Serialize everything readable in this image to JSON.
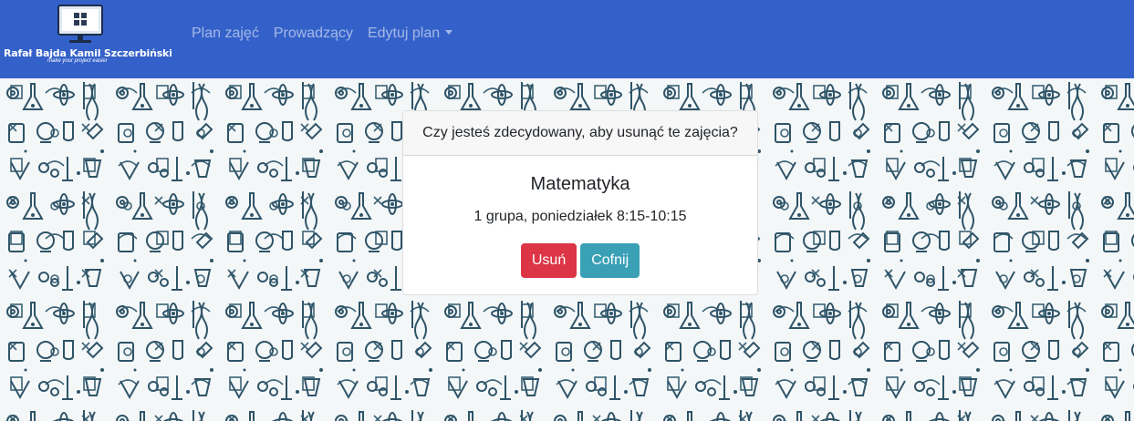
{
  "brand": {
    "name": "Rafał Bajda Kamil Szczerbiński",
    "tagline": "make your project easier",
    "logo_icon": "monitor-windows-icon"
  },
  "nav": {
    "items": [
      {
        "label": "Plan zajęć"
      },
      {
        "label": "Prowadzący"
      },
      {
        "label": "Edytuj plan"
      }
    ]
  },
  "dialog": {
    "header": "Czy jesteś zdecydowany, aby usunąć te zajęcia?",
    "course_name": "Matematyka",
    "course_detail": "1 grupa, poniedziałek 8:15-10:15",
    "delete_label": "Usuń",
    "back_label": "Cofnij"
  },
  "colors": {
    "navbar": "#3461c9",
    "danger": "#dc3545",
    "info": "#3aa0b6"
  }
}
